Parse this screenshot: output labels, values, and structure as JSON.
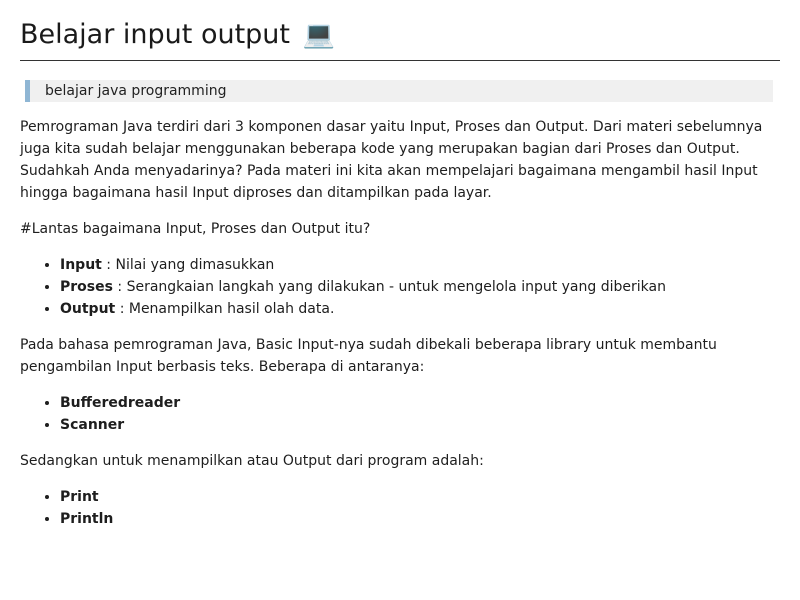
{
  "title": "Belajar input output",
  "title_icon": "laptop-icon",
  "title_icon_glyph": "💻",
  "blockquote": "belajar java programming",
  "intro": "Pemrograman Java terdiri dari 3 komponen dasar yaitu Input, Proses dan Output. Dari materi sebelumnya juga kita sudah belajar menggunakan beberapa kode yang merupakan bagian dari Proses dan Output. Sudahkah Anda menyadarinya? Pada materi ini kita akan mempelajari bagaimana mengambil hasil Input hingga bagaimana hasil Input diproses dan ditampilkan pada layar.",
  "question": "#Lantas bagaimana Input, Proses dan Output itu?",
  "components": [
    {
      "term": "Input",
      "desc": " : Nilai yang dimasukkan"
    },
    {
      "term": "Proses",
      "desc": " : Serangkaian langkah yang dilakukan - untuk mengelola input yang diberikan"
    },
    {
      "term": "Output",
      "desc": " : Menampilkan hasil olah data."
    }
  ],
  "input_paragraph": "Pada bahasa pemrograman Java, Basic Input-nya sudah dibekali beberapa library untuk membantu pengambilan Input berbasis teks. Beberapa di antaranya:",
  "input_libraries": [
    "Bufferedreader",
    "Scanner"
  ],
  "output_paragraph": "Sedangkan untuk menampilkan atau Output dari program adalah:",
  "output_methods": [
    "Print",
    "Println"
  ],
  "colors": {
    "blockquote_border": "#8fb6d4",
    "blockquote_bg": "#f0f0f0",
    "text": "#1e1e1e"
  }
}
